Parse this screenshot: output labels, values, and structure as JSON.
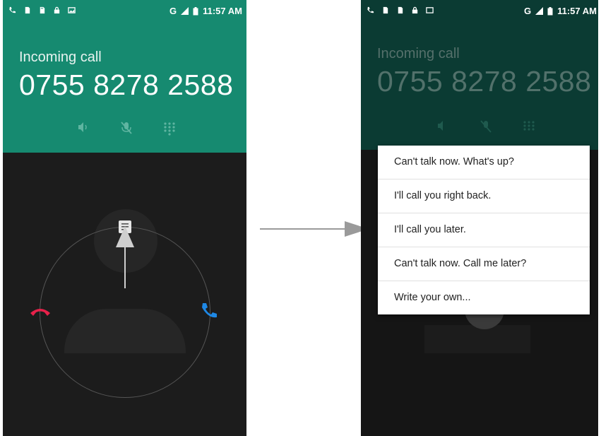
{
  "left_screen": {
    "status_bar": {
      "network": "G",
      "time": "11:57 AM"
    },
    "incoming_label": "Incoming call",
    "phone_number": "0755 8278 2588",
    "controls": [
      "speaker-icon",
      "mute-icon",
      "dialpad-icon"
    ]
  },
  "right_screen": {
    "status_bar": {
      "network": "G",
      "time": "11:57 AM"
    },
    "incoming_label": "Incoming call",
    "phone_number": "0755 8278 2588",
    "quick_responses": [
      "Can't talk now. What's up?",
      "I'll call you right back.",
      "I'll call you later.",
      "Can't talk now. Call me later?",
      "Write your own..."
    ]
  },
  "colors": {
    "header_teal": "#168a70",
    "decline_red": "#e8214a",
    "answer_blue": "#1e88e5"
  }
}
